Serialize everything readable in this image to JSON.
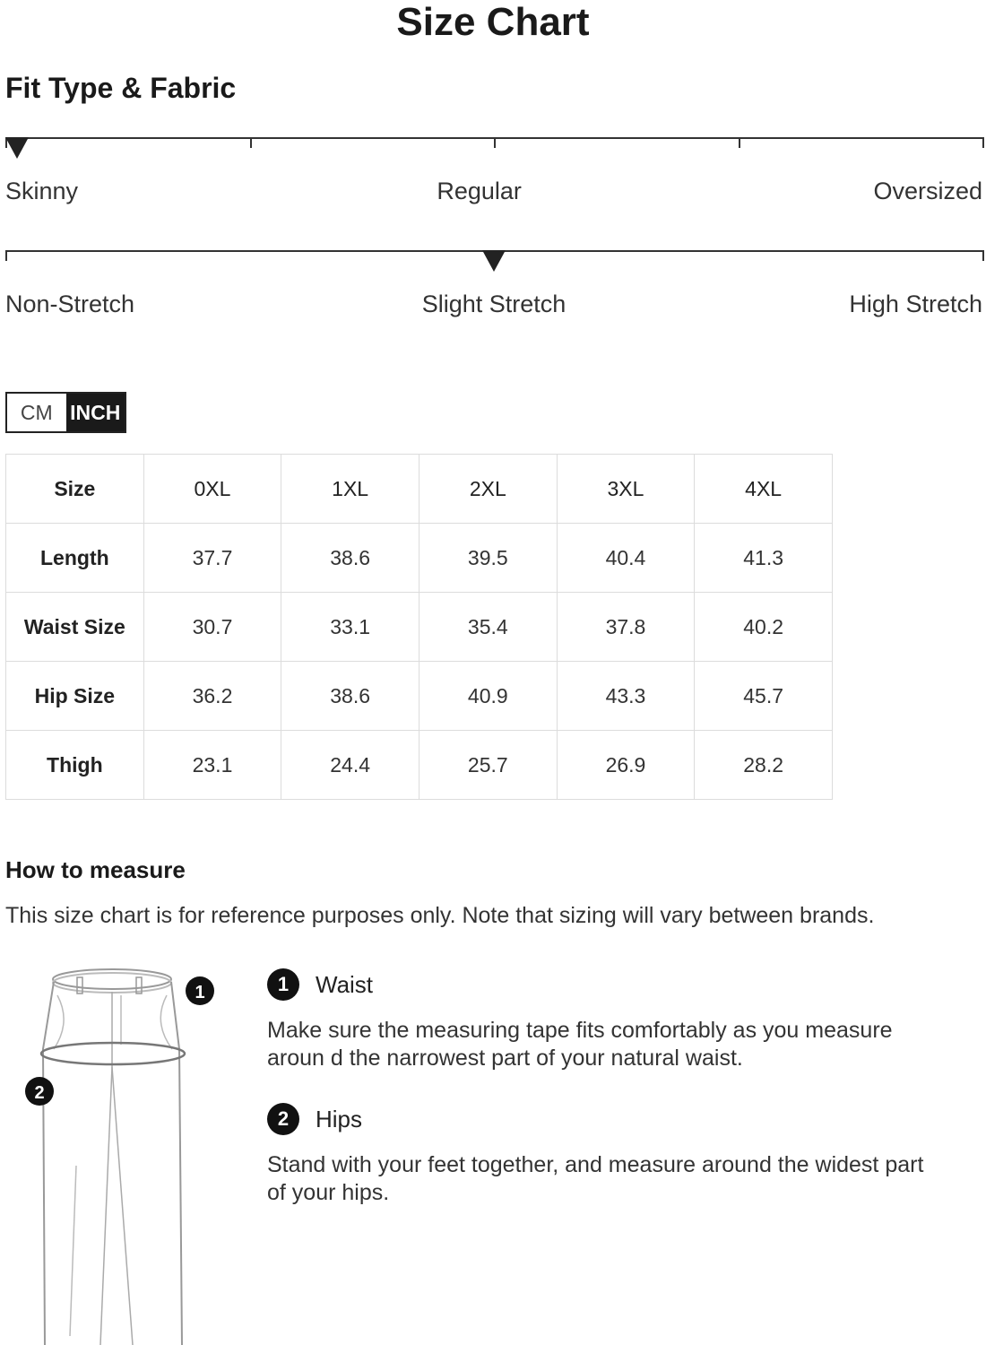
{
  "title": "Size Chart",
  "fit_section": {
    "heading": "Fit Type & Fabric",
    "fit_scale": {
      "labels": [
        "Skinny",
        "Regular",
        "Oversized"
      ],
      "selected": "Skinny"
    },
    "stretch_scale": {
      "labels": [
        "Non-Stretch",
        "Slight Stretch",
        "High Stretch"
      ],
      "selected": "Slight Stretch"
    }
  },
  "unit_toggle": {
    "options": [
      "CM",
      "INCH"
    ],
    "active": "INCH"
  },
  "size_table": {
    "header": [
      "Size",
      "0XL",
      "1XL",
      "2XL",
      "3XL",
      "4XL"
    ],
    "rows": [
      [
        "Length",
        "37.7",
        "38.6",
        "39.5",
        "40.4",
        "41.3"
      ],
      [
        "Waist Size",
        "30.7",
        "33.1",
        "35.4",
        "37.8",
        "40.2"
      ],
      [
        "Hip Size",
        "36.2",
        "38.6",
        "40.9",
        "43.3",
        "45.7"
      ],
      [
        "Thigh",
        "23.1",
        "24.4",
        "25.7",
        "26.9",
        "28.2"
      ]
    ]
  },
  "how_to_measure": {
    "heading": "How to measure",
    "disclaimer": "This size chart is for reference purposes only. Note that sizing will vary between brands.",
    "illustration_markers": [
      "1",
      "2"
    ],
    "steps": [
      {
        "number": "1",
        "name": "Waist",
        "text": "Make sure the measuring tape fits comfortably as you measure aroun d the narrowest part of your natural waist."
      },
      {
        "number": "2",
        "name": "Hips",
        "text": "Stand with your feet together, and measure around the widest part of your hips."
      }
    ]
  },
  "colors": {
    "text": "#222222",
    "accent": "#1a1a1a",
    "grid": "#dcdcdc"
  }
}
